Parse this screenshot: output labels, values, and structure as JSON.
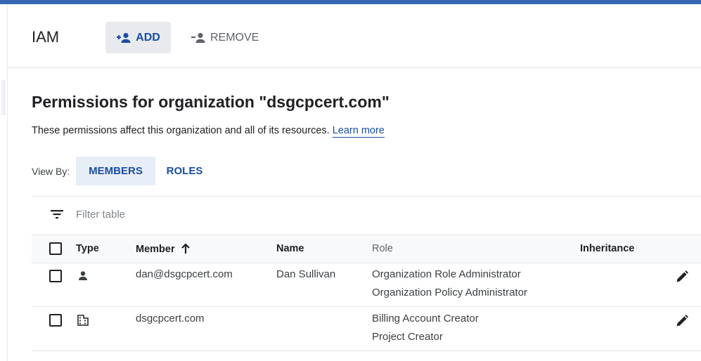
{
  "header": {
    "title": "IAM",
    "add_label": "ADD",
    "remove_label": "REMOVE"
  },
  "permissions": {
    "title": "Permissions for organization \"dsgcpcert.com\"",
    "description": "These permissions affect this organization and all of its resources.",
    "learn_more": "Learn more"
  },
  "view_by": {
    "label": "View By:",
    "tabs": [
      {
        "label": "MEMBERS",
        "selected": true
      },
      {
        "label": "ROLES",
        "selected": false
      }
    ]
  },
  "filter": {
    "placeholder": "Filter table",
    "icon": "filter-icon"
  },
  "table": {
    "columns": {
      "type": "Type",
      "member": "Member",
      "name": "Name",
      "role": "Role",
      "inheritance": "Inheritance"
    },
    "sort_icon": "arrow-up-icon",
    "rows": [
      {
        "type_icon": "person-icon",
        "member": "dan@dsgcpcert.com",
        "name": "Dan Sullivan",
        "roles": [
          "Organization Role Administrator",
          "Organization Policy Administrator"
        ],
        "inheritance": ""
      },
      {
        "type_icon": "domain-icon",
        "member": "dsgcpcert.com",
        "name": "",
        "roles": [
          "Billing Account Creator",
          "Project Creator"
        ],
        "inheritance": ""
      }
    ]
  },
  "colors": {
    "accent": "#1a4ea3",
    "top_bar": "#3567b5",
    "selected_tab_bg": "#e8eef7"
  }
}
